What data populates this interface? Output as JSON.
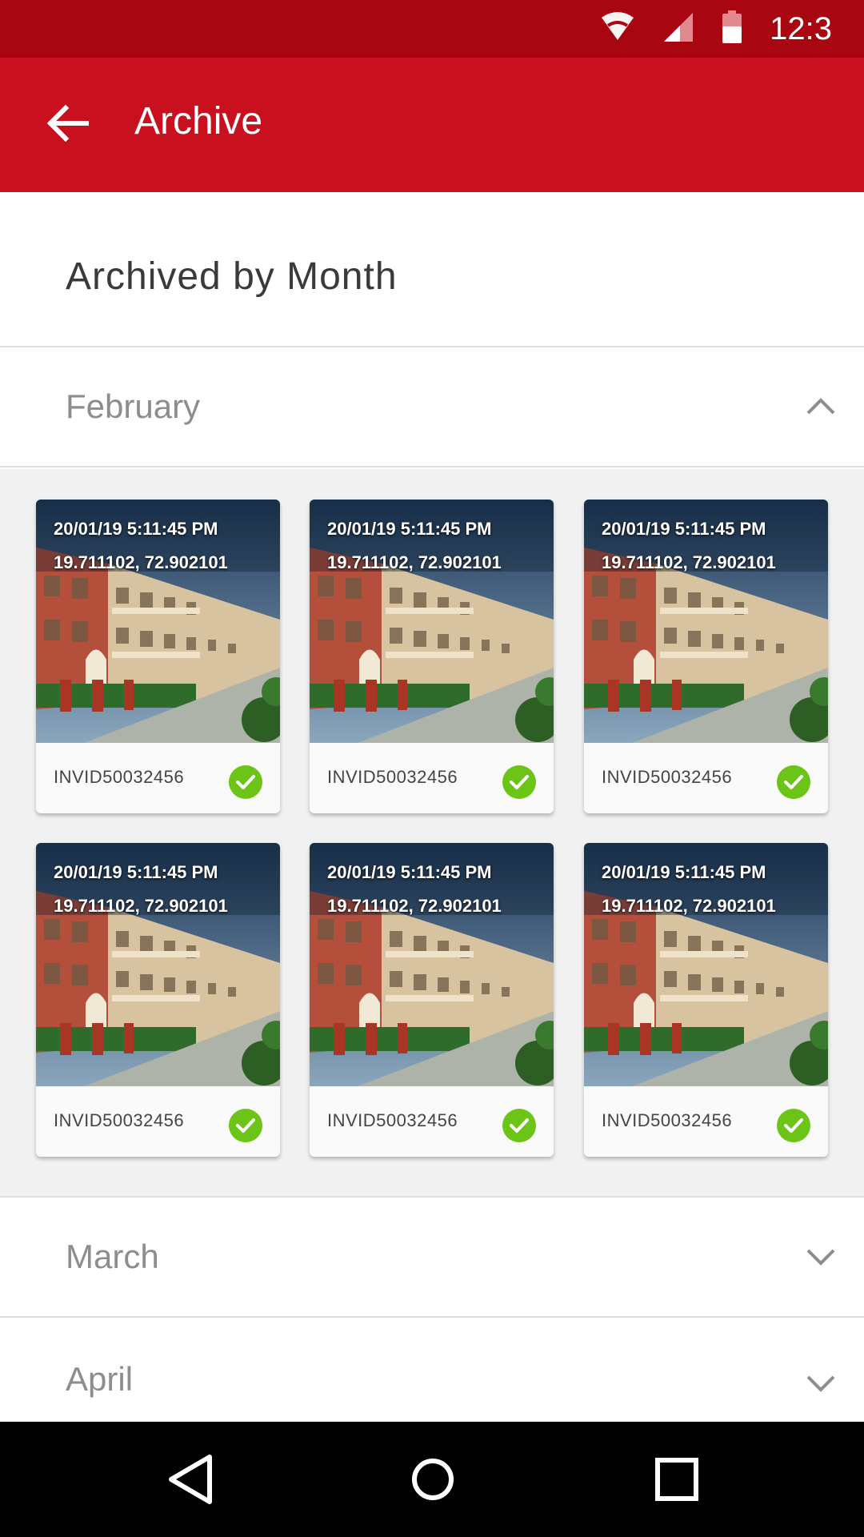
{
  "status_bar": {
    "time": "12:3",
    "icons": [
      "wifi-icon",
      "cellular-signal-icon",
      "battery-icon"
    ]
  },
  "app_bar": {
    "back_icon": "arrow-back-icon",
    "title": "Archive"
  },
  "section": {
    "title": "Archived by Month"
  },
  "months": [
    {
      "label": "February",
      "expanded": true,
      "icon": "chevron-up-icon"
    },
    {
      "label": "March",
      "expanded": false,
      "icon": "chevron-down-icon"
    },
    {
      "label": "April",
      "expanded": false,
      "icon": "chevron-down-icon"
    }
  ],
  "photos": [
    {
      "timestamp": "20/01/19  5:11:45 PM",
      "coords": "19.711102, 72.902101",
      "id": "INVID50032456",
      "status_icon": "check-circle-icon"
    },
    {
      "timestamp": "20/01/19  5:11:45 PM",
      "coords": "19.711102, 72.902101",
      "id": "INVID50032456",
      "status_icon": "check-circle-icon"
    },
    {
      "timestamp": "20/01/19  5:11:45 PM",
      "coords": "19.711102, 72.902101",
      "id": "INVID50032456",
      "status_icon": "check-circle-icon"
    },
    {
      "timestamp": "20/01/19  5:11:45 PM",
      "coords": "19.711102, 72.902101",
      "id": "INVID50032456",
      "status_icon": "check-circle-icon"
    },
    {
      "timestamp": "20/01/19  5:11:45 PM",
      "coords": "19.711102, 72.902101",
      "id": "INVID50032456",
      "status_icon": "check-circle-icon"
    },
    {
      "timestamp": "20/01/19  5:11:45 PM",
      "coords": "19.711102, 72.902101",
      "id": "INVID50032456",
      "status_icon": "check-circle-icon"
    }
  ],
  "nav_bar": {
    "icons": [
      "back-triangle-icon",
      "home-circle-icon",
      "recents-square-icon"
    ]
  },
  "colors": {
    "status_bar": "#a80712",
    "app_bar": "#c8101e",
    "check": "#6cc416",
    "grid_bg": "#f1f1f1"
  }
}
